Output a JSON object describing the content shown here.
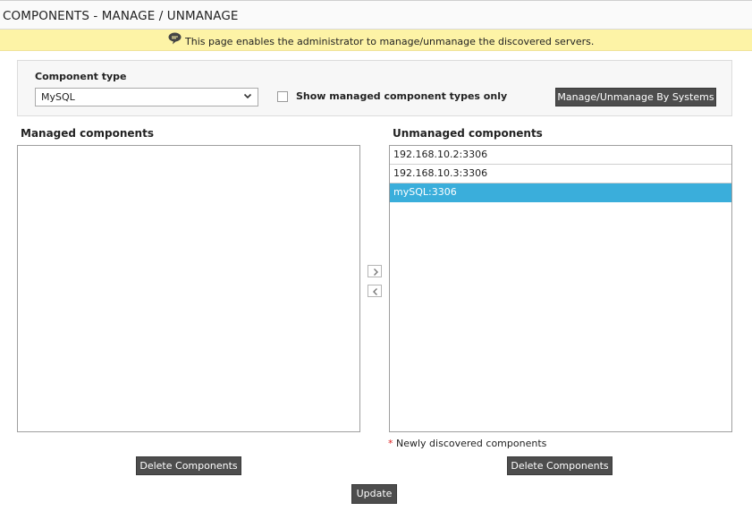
{
  "header": {
    "title": "COMPONENTS - MANAGE / UNMANAGE"
  },
  "info": {
    "icon": "speech-bubble-icon",
    "text": "This page enables the administrator to manage/unmanage the discovered servers."
  },
  "filter": {
    "component_type_label": "Component type",
    "component_type_value": "MySQL",
    "show_managed_label": "Show managed component types only",
    "show_managed_checked": false,
    "manage_by_systems_label": "Manage/Unmanage By Systems"
  },
  "managed": {
    "title": "Managed components",
    "items": []
  },
  "unmanaged": {
    "title": "Unmanaged components",
    "items": [
      {
        "label": "192.168.10.2:3306",
        "selected": false
      },
      {
        "label": "192.168.10.3:3306",
        "selected": false
      },
      {
        "label": "mySQL:3306",
        "selected": true
      }
    ]
  },
  "note": {
    "star": "*",
    "text": "Newly discovered components"
  },
  "buttons": {
    "delete_left": "Delete Components",
    "delete_right": "Delete Components",
    "update": "Update"
  },
  "colors": {
    "info_bar_bg": "#fdf3a6",
    "selected_bg": "#3aaedb",
    "button_bg": "#4d4d4d"
  }
}
